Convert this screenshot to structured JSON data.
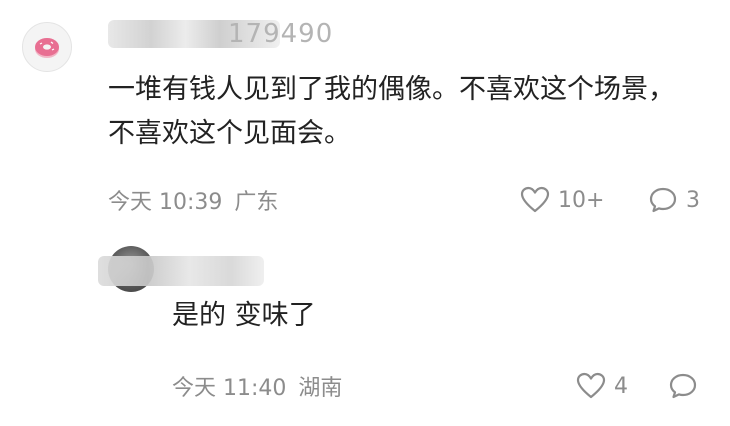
{
  "comment": {
    "username_visible_tail": "179490",
    "text_lines": [
      "一堆有钱人见到了我的偶像。不喜欢这个场景，",
      "不喜欢这个见面会。"
    ],
    "time": "今天 10:39",
    "location": "广东",
    "like_count": "10+",
    "reply_count": "3"
  },
  "reply": {
    "text": "是的 变味了",
    "time": "今天 11:40",
    "location": "湖南",
    "like_count": "4"
  },
  "icons": {
    "like": "heart-outline-icon",
    "comment": "speech-bubble-icon",
    "avatar": "donut-icon"
  },
  "colors": {
    "meta_text": "#8c8c8c",
    "body_text": "#222222",
    "donut_pink": "#e86f92"
  }
}
